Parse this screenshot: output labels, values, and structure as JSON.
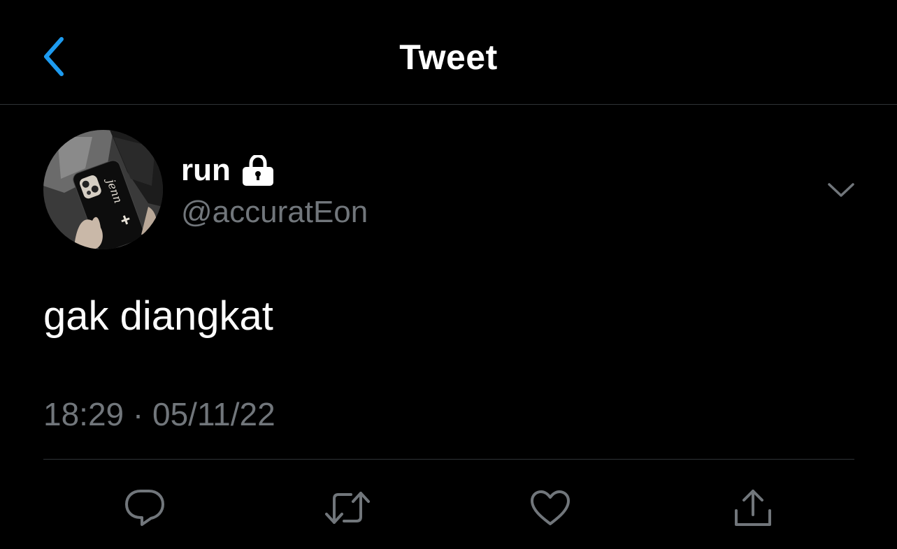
{
  "header": {
    "title": "Tweet"
  },
  "tweet": {
    "author": {
      "display_name": "run",
      "handle": "@accuratEon",
      "protected": true,
      "avatar_phone_text": "jenn"
    },
    "text": "gak diangkat",
    "time": "18:29",
    "separator": "·",
    "date": "05/11/22"
  },
  "actions": [
    "reply",
    "retweet",
    "like",
    "share"
  ],
  "icons": {
    "back": "chevron-left-icon",
    "lock": "lock-icon",
    "more": "chevron-down-icon",
    "reply": "speech-bubble-icon",
    "retweet": "retweet-arrows-icon",
    "like": "heart-icon",
    "share": "share-upload-icon"
  },
  "colors": {
    "background": "#000000",
    "text": "#ffffff",
    "muted": "#71767b",
    "accent": "#1d9bf0",
    "divider": "#2f3336"
  }
}
